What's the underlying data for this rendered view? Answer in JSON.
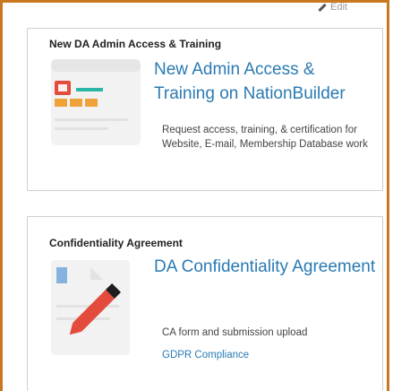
{
  "edit_label": "Edit",
  "cards": [
    {
      "heading": "New DA Admin Access & Training",
      "link_title": "New Admin Access & Training on NationBuilder",
      "description": "Request access, training, & certification for Website, E-mail, Membership Database work",
      "icon": "admin-panel-icon"
    },
    {
      "heading": "Confidentiality Agreement",
      "link_title": "DA Confidentiality Agreement",
      "description": "CA form and submission upload",
      "extra_link": "GDPR Compliance",
      "icon": "document-pencil-icon"
    }
  ],
  "colors": {
    "frame": "#c9781f",
    "link": "#2a7ab3",
    "icon_red": "#e34b3c",
    "icon_teal": "#2bb7a8",
    "icon_orange": "#f0a23a",
    "icon_blue": "#87b2e0"
  }
}
